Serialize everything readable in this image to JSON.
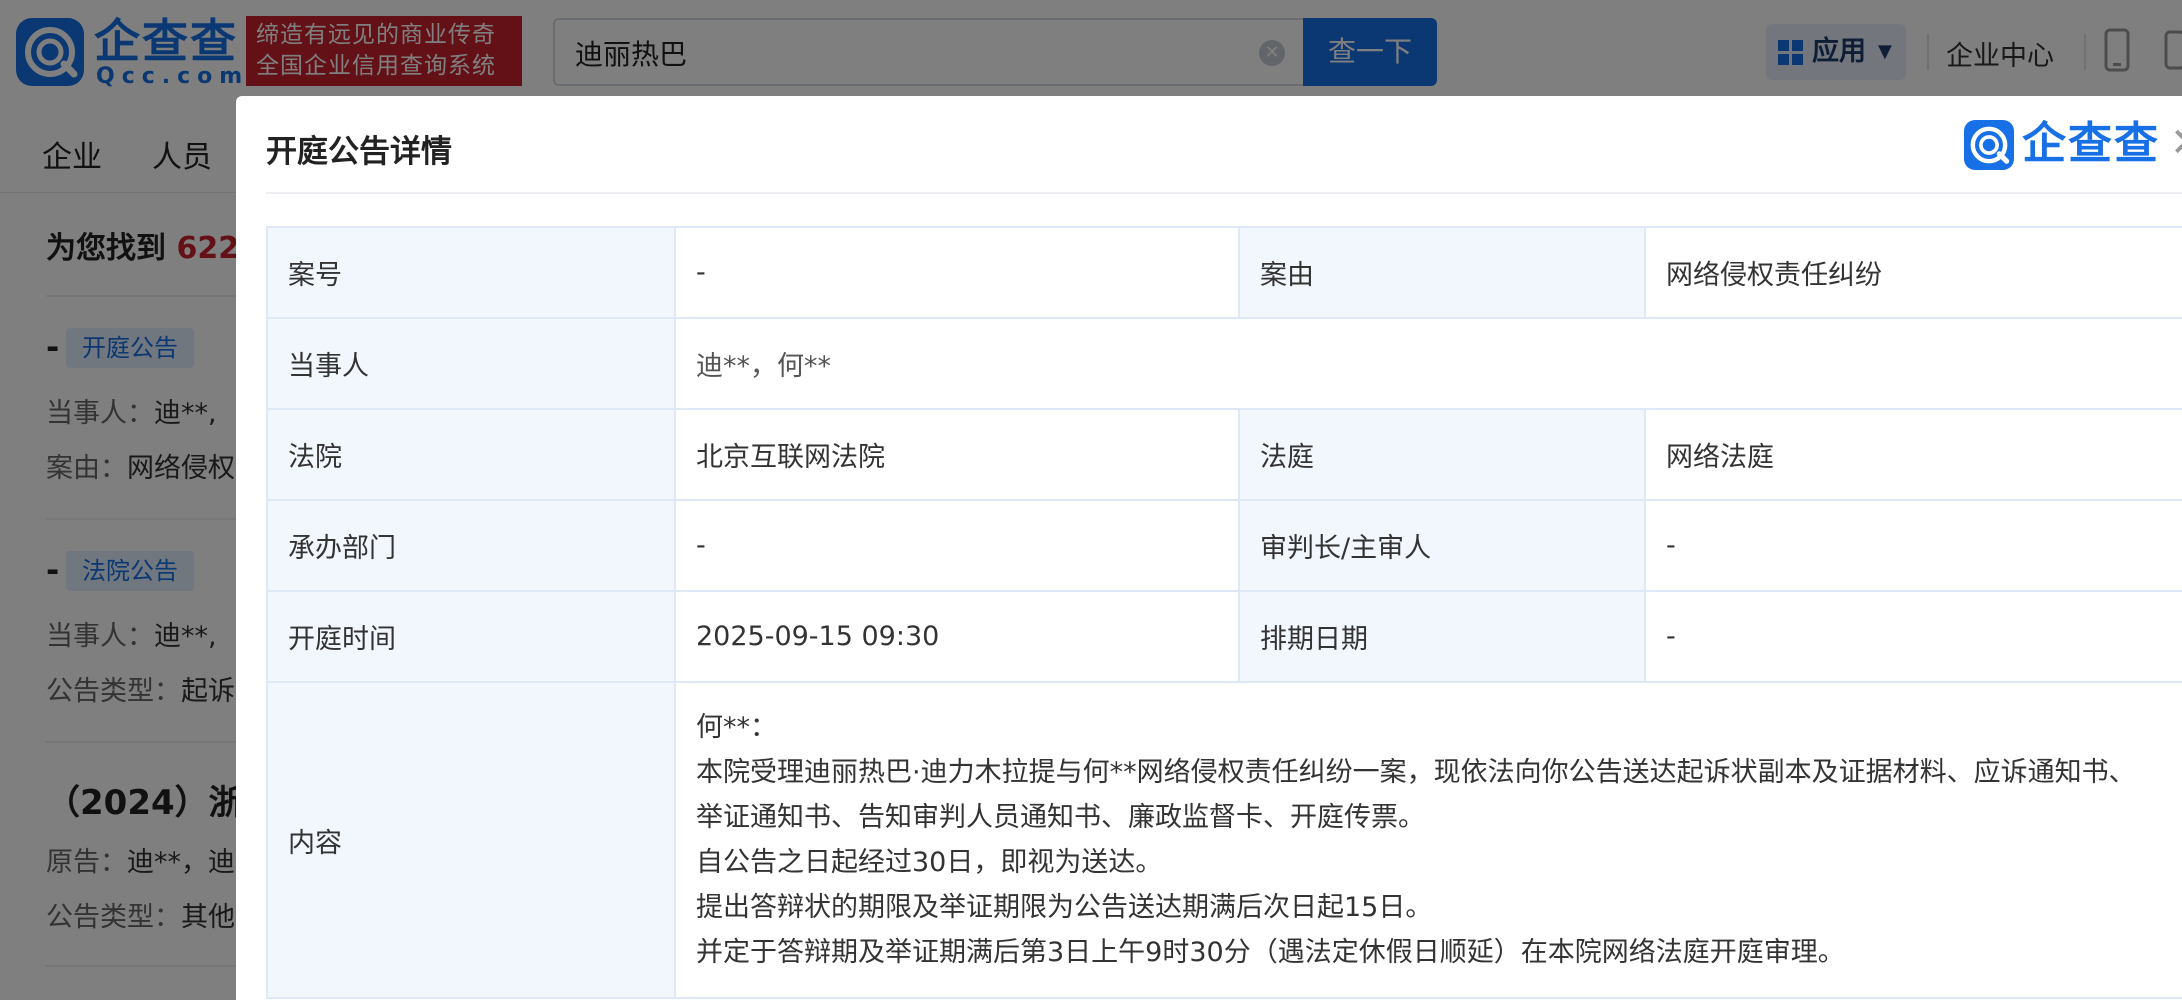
{
  "header": {
    "logo_text": "企查查",
    "logo_sub": "Qcc.com",
    "slogan_line1": "缔造有远见的商业传奇",
    "slogan_line2": "全国企业信用查询系统",
    "search_value": "迪丽热巴",
    "search_button": "查一下",
    "apps_label": "应用",
    "enterprise_center": "企业中心"
  },
  "nav": {
    "items": [
      "企业",
      "人员"
    ]
  },
  "results": {
    "found_prefix": "为您找到",
    "found_count": "622",
    "items": [
      {
        "dash": "-",
        "tag": "开庭公告",
        "line1_label": "当事人：",
        "line1_value": "迪**,",
        "line2_label": "案由：",
        "line2_value": "网络侵权"
      },
      {
        "dash": "-",
        "tag": "法院公告",
        "line1_label": "当事人：",
        "line1_value": "迪**,",
        "line2_label": "公告类型：",
        "line2_value": "起诉"
      },
      {
        "title": "（2024）浙",
        "line1_label": "原告：",
        "line1_value": "迪**，迪",
        "line2_label": "公告类型：",
        "line2_value": "其他"
      }
    ]
  },
  "modal": {
    "title": "开庭公告详情",
    "brand": "企查查",
    "rows": {
      "case_no_label": "案号",
      "case_no_value": "-",
      "cause_label": "案由",
      "cause_value": "网络侵权责任纠纷",
      "parties_label": "当事人",
      "parties_value": "迪**，何**",
      "court_label": "法院",
      "court_value": "北京互联网法院",
      "tribunal_label": "法庭",
      "tribunal_value": "网络法庭",
      "dept_label": "承办部门",
      "dept_value": "-",
      "judge_label": "审判长/主审人",
      "judge_value": "-",
      "time_label": "开庭时间",
      "time_value": "2025-09-15 09:30",
      "schedule_label": "排期日期",
      "schedule_value": "-",
      "content_label": "内容",
      "content_lines": [
        "何**：",
        "本院受理迪丽热巴·迪力木拉提与何**网络侵权责任纠纷一案，现依法向你公告送达起诉状副本及证据材料、应诉通知书、",
        "举证通知书、告知审判人员通知书、廉政监督卡、开庭传票。",
        "自公告之日起经过30日，即视为送达。",
        "提出答辩状的期限及举证期限为公告送达期满后次日起15日。",
        "并定于答辩期及举证期满后第3日上午9时30分（遇法定休假日顺延）在本院网络法庭开庭审理。"
      ]
    }
  },
  "colors": {
    "brand_blue": "#1770e6",
    "slogan_red": "#c8202f",
    "table_key_bg": "#f2f7fe",
    "overlay": "rgba(0,0,0,0.5)"
  }
}
